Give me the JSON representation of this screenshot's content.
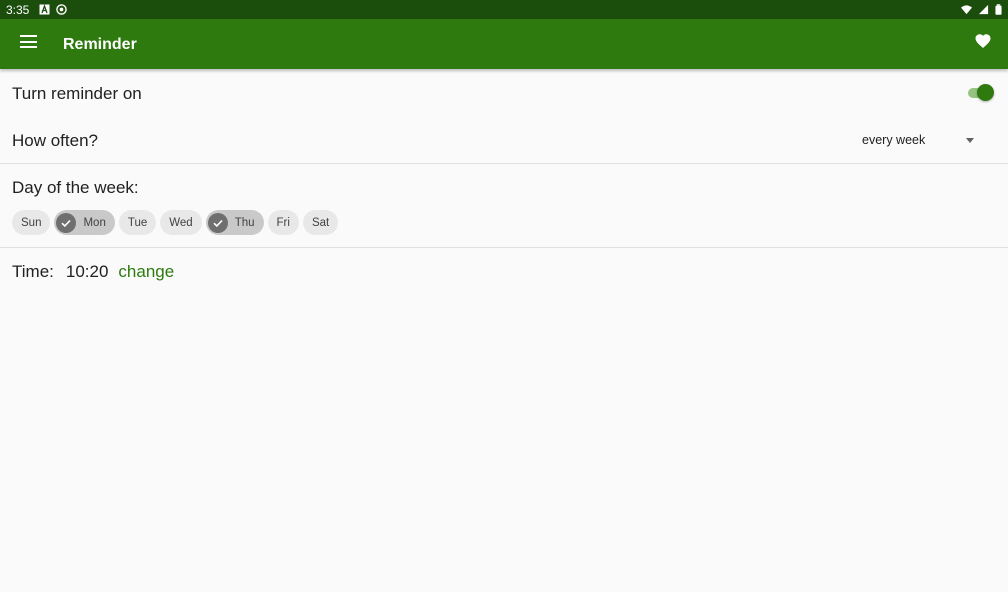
{
  "status_bar": {
    "time": "3:35",
    "left_icons": [
      "a-icon",
      "sync-icon"
    ],
    "right_icons": [
      "wifi-icon",
      "signal-icon",
      "battery-icon"
    ]
  },
  "app_bar": {
    "title": "Reminder",
    "menu_icon": "menu-icon",
    "action_icon": "heart-icon",
    "color": "#2e7a0f"
  },
  "reminder": {
    "toggle_label": "Turn reminder on",
    "toggle_on": true,
    "how_often_label": "How often?",
    "how_often_value": "every week",
    "day_label": "Day of the week:",
    "days": [
      {
        "label": "Sun",
        "selected": false
      },
      {
        "label": "Mon",
        "selected": true
      },
      {
        "label": "Tue",
        "selected": false
      },
      {
        "label": "Wed",
        "selected": false
      },
      {
        "label": "Thu",
        "selected": true
      },
      {
        "label": "Fri",
        "selected": false
      },
      {
        "label": "Sat",
        "selected": false
      }
    ],
    "time_label": "Time:",
    "time_value": "10:20",
    "change_label": "change"
  }
}
